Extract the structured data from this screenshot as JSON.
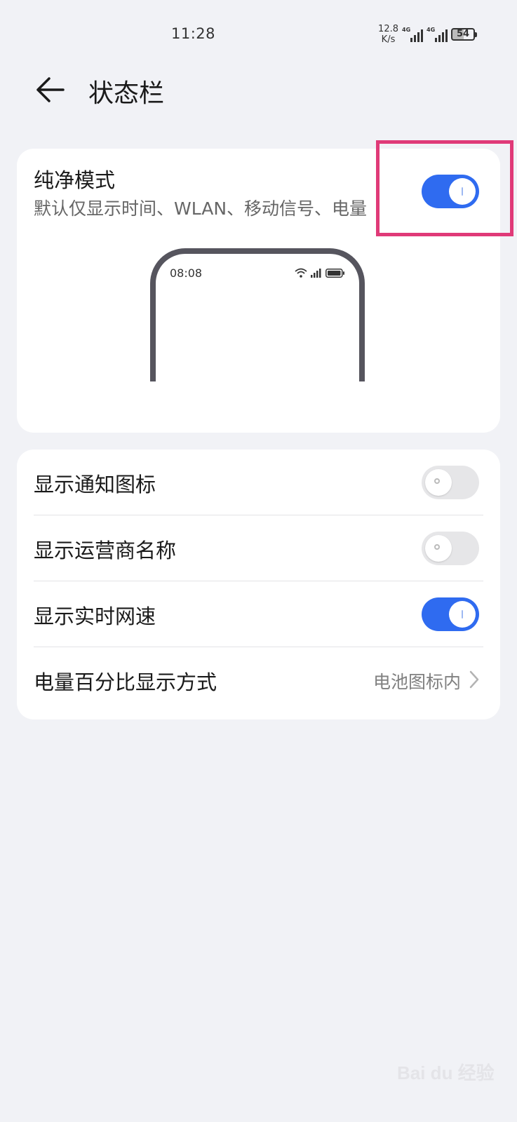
{
  "status_bar": {
    "time": "11:28",
    "net_speed_value": "12.8",
    "net_speed_unit": "K/s",
    "sim1_tag": "4G",
    "sim2_tag": "4G",
    "battery": "54"
  },
  "header": {
    "title": "状态栏",
    "back_icon": "back-arrow-icon"
  },
  "pure_mode": {
    "title": "纯净模式",
    "subtitle": "默认仅显示时间、WLAN、移动信号、电量",
    "enabled": true,
    "preview_time": "08:08"
  },
  "settings": [
    {
      "label": "显示通知图标",
      "enabled": false
    },
    {
      "label": "显示运营商名称",
      "enabled": false
    },
    {
      "label": "显示实时网速",
      "enabled": true
    },
    {
      "label": "电量百分比显示方式",
      "value": "电池图标内"
    }
  ],
  "watermark": "Bai du 经验",
  "colors": {
    "accent": "#2f6bf0",
    "highlight": "#e03a78",
    "background": "#f1f2f6"
  }
}
